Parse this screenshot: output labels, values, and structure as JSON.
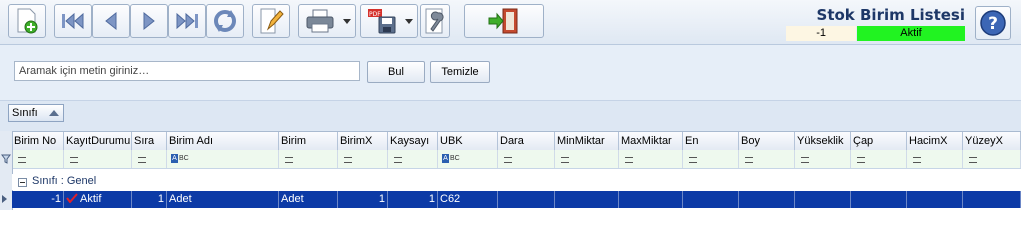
{
  "header": {
    "title": "Stok Birim Listesi",
    "count": "-1",
    "status": "Aktif",
    "status_color": "#21f321"
  },
  "toolbar": {
    "buttons": [
      {
        "name": "new-record-button",
        "icon": "new-document-icon"
      },
      {
        "name": "first-record-button",
        "icon": "first-icon"
      },
      {
        "name": "previous-record-button",
        "icon": "previous-icon"
      },
      {
        "name": "next-record-button",
        "icon": "next-icon"
      },
      {
        "name": "last-record-button",
        "icon": "last-icon"
      },
      {
        "name": "refresh-button",
        "icon": "refresh-icon"
      },
      {
        "name": "edit-button",
        "icon": "pencil-icon"
      },
      {
        "name": "print-button",
        "icon": "printer-icon"
      },
      {
        "name": "export-pdf-button",
        "icon": "pdf-save-icon"
      },
      {
        "name": "settings-button",
        "icon": "wrench-icon"
      },
      {
        "name": "exit-button",
        "icon": "exit-door-icon"
      },
      {
        "name": "help-button",
        "icon": "help-icon"
      }
    ]
  },
  "search": {
    "placeholder": "Aramak için metin giriniz…",
    "find_label": "Bul",
    "clear_label": "Temizle"
  },
  "group_panel": {
    "chip_label": "Sınıfı"
  },
  "grid": {
    "columns": [
      "Birim No",
      "KayıtDurumu",
      "Sıra",
      "Birim Adı",
      "Birim",
      "BirimX",
      "Kaysayı",
      "UBK",
      "Dara",
      "MinMiktar",
      "MaxMiktar",
      "En",
      "Boy",
      "Yükseklik",
      "Çap",
      "HacimX",
      "YüzeyX"
    ],
    "group_row": "Sınıfı : Genel",
    "rows": [
      {
        "birim_no": "-1",
        "kayit_durumu": "Aktif",
        "sira": "1",
        "birim_adi": "Adet",
        "birim": "Adet",
        "birim_x": "1",
        "kaysayi": "1",
        "ubk": "C62"
      }
    ]
  }
}
